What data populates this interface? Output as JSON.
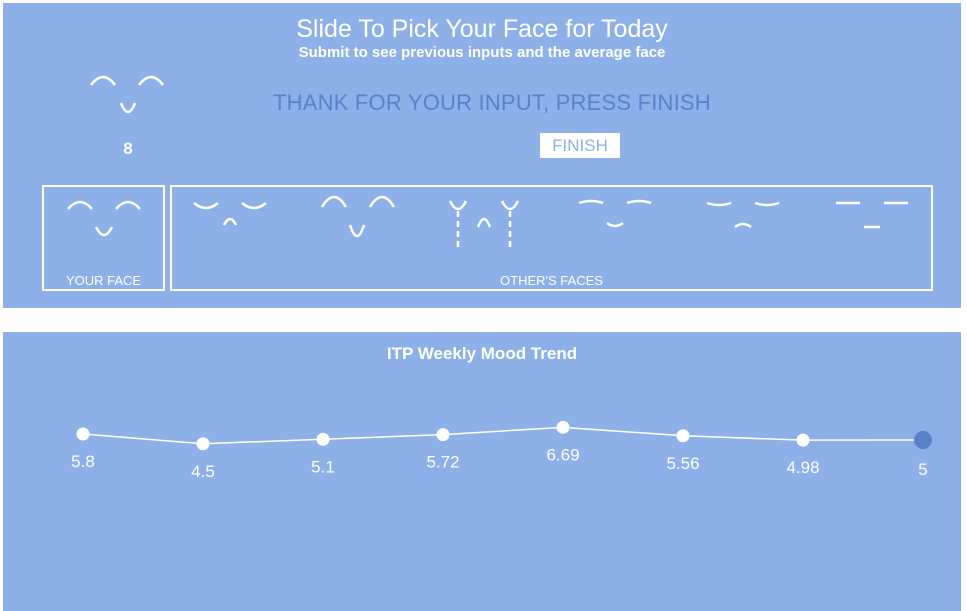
{
  "header": {
    "title": "Slide To Pick Your Face for Today",
    "subtitle": "Submit to see previous inputs and the average face"
  },
  "message": "THANK FOR YOUR INPUT, PRESS FINISH",
  "finish_button": "FINISH",
  "slider": {
    "value": "8"
  },
  "your_face": {
    "label": "YOUR FACE",
    "icon": "smiling-face-icon"
  },
  "others_faces": {
    "label": "OTHER'S FACES",
    "icons": [
      "sad-face-icon",
      "smiling-face-icon",
      "crying-face-icon",
      "neutral-face-icon",
      "frowning-face-icon",
      "flat-face-icon"
    ]
  },
  "colors": {
    "panel": "#8db0e8",
    "accent_text": "#5a82c8",
    "last_point": "#5a82c8"
  },
  "chart_data": {
    "type": "line",
    "title": "ITP Weekly Mood Trend",
    "x": [
      1,
      2,
      3,
      4,
      5,
      6,
      7,
      8
    ],
    "values": [
      5.8,
      4.5,
      5.1,
      5.72,
      6.69,
      5.56,
      4.98,
      5
    ],
    "labels": [
      "5.8",
      "4.5",
      "5.1",
      "5.72",
      "6.69",
      "5.56",
      "4.98",
      "5"
    ],
    "ylim": [
      0,
      10
    ],
    "grid": false
  }
}
